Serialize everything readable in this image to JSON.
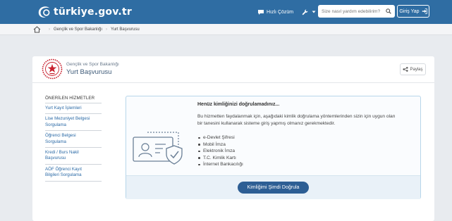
{
  "header": {
    "logo_text": "türkiye.gov.tr",
    "quick_solution": "Hızlı Çözüm",
    "search_placeholder": "Size nasıl yardım edebilirim?",
    "login_label": "Giriş Yap",
    "bar_color": "#2f6da3"
  },
  "breadcrumb": {
    "items": [
      "Gençlik ve Spor Bakanlığı",
      "Yurt Başvurusu"
    ]
  },
  "service": {
    "ministry": "Gençlik ve Spor Bakanlığı",
    "title": "Yurt Başvurusu",
    "share_label": "Paylaş"
  },
  "sidebar": {
    "heading": "ÖNERİLEN HİZMETLER",
    "items": [
      {
        "label_1": "Yurt Kayıt İşlemleri",
        "label_2": ""
      },
      {
        "label_1": "Lise Mezuniyet Belgesi",
        "label_2": "Sorgulama"
      },
      {
        "label_1": "Öğrenci Belgesi",
        "label_2": "Sorgulama"
      },
      {
        "label_1": "Kredi / Burs Nakil",
        "label_2": "Başvurusu"
      },
      {
        "label_1": "AÖF Öğrenci Kayıt",
        "label_2": "Bilgileri Sorgulama"
      }
    ]
  },
  "panel": {
    "title": "Henüz kimliğinizi doğrulamadınız...",
    "desc_1": "Bu hizmetten faydalanmak için, aşağıdaki kimlik doğrulama yöntemlerinden sizin için uygun olan",
    "desc_2": "bir tanesini kullanarak sisteme giriş yapmış olmanız gerekmektedir.",
    "methods": [
      "e-Devlet Şifresi",
      "Mobil İmza",
      "Elektronik İmza",
      "T.C. Kimlik Kartı",
      "İnternet Bankacılığı"
    ],
    "button_label": "Kimliğimi Şimdi Doğrula"
  }
}
